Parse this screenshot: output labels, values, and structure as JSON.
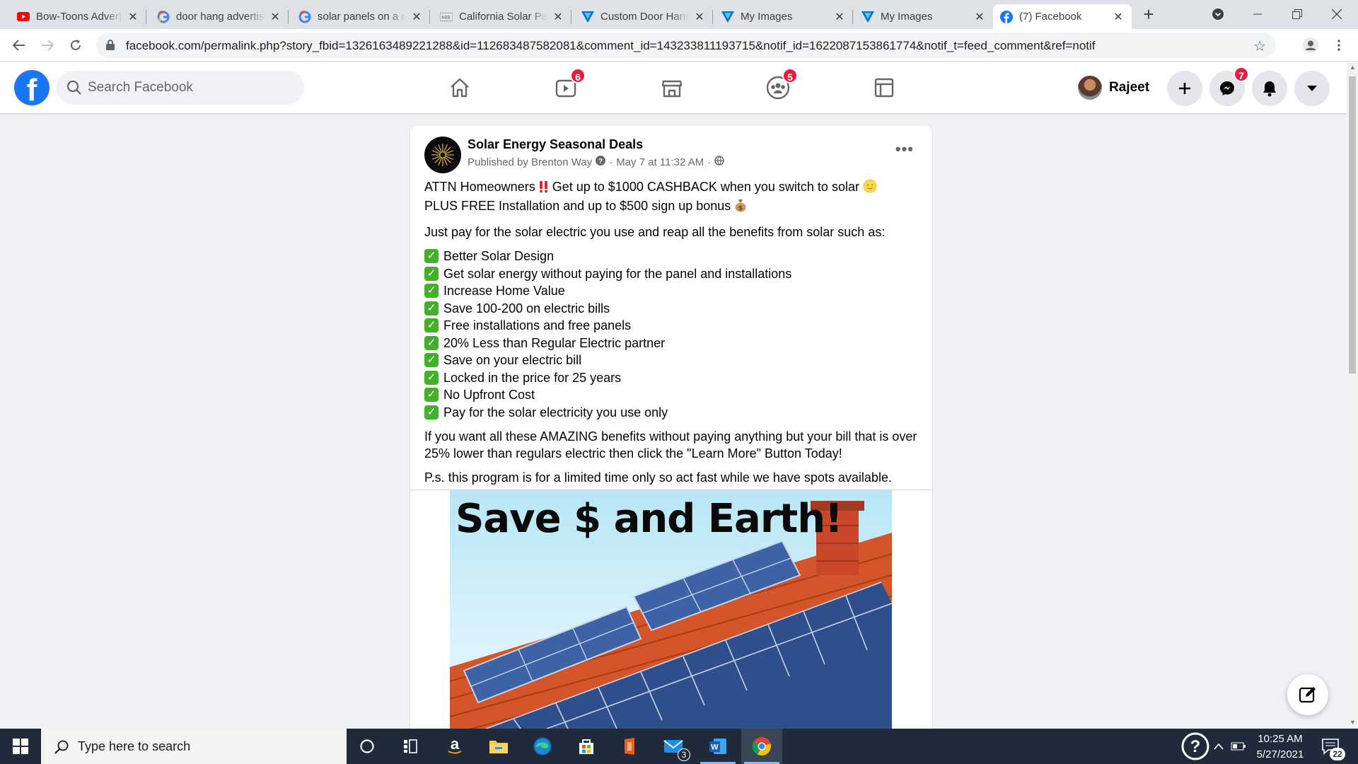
{
  "browser": {
    "tabs": [
      {
        "title": "Bow-Toons Advertising"
      },
      {
        "title": "door hang advertising"
      },
      {
        "title": "solar panels on a roof"
      },
      {
        "title": "California Solar Panels"
      },
      {
        "title": "Custom Door Hangers"
      },
      {
        "title": "My Images"
      },
      {
        "title": "My Images"
      },
      {
        "title": "(7) Facebook"
      }
    ],
    "url": "facebook.com/permalink.php?story_fbid=1326163489221288&id=112683487582081&comment_id=143233811193715&notif_id=1622087153861774&notif_t=feed_comment&ref=notif"
  },
  "fb": {
    "search_placeholder": "Search Facebook",
    "watch_badge": "6",
    "groups_badge": "5",
    "messenger_badge": "7",
    "profile_name": "Rajeet"
  },
  "post": {
    "page_name": "Solar Energy Seasonal Deals",
    "meta_author": "Published by Brenton Way",
    "meta_date": "May 7 at 11:32 AM",
    "para1_a": "ATTN Homeowners",
    "para1_b": " Get up to $1000 CASHBACK when you switch to solar ",
    "para1_c": "PLUS FREE Installation and up to $500 sign up bonus ",
    "para2": "Just pay for the solar electric you use  and reap all the benefits from solar such as:",
    "benefits": [
      "Better Solar Design",
      "Get solar energy without paying for the panel and installations",
      "Increase Home Value",
      "Save 100-200 on electric bills",
      "Free installations and free panels",
      "20% Less than Regular Electric partner",
      "Save on your electric bill",
      "Locked in the price for 25 years",
      "No Upfront Cost",
      "Pay for the solar electricity you use only"
    ],
    "para3": "If you want all these AMAZING benefits without paying anything but your bill that is over 25% lower than regulars electric then click the \"Learn More\" Button Today!",
    "para4": "P.s. this program is for a limited time only so act fast while we have spots available.",
    "image_headline": "Save $ and Earth!"
  },
  "taskbar": {
    "search_placeholder": "Type here to search",
    "mail_count": "3",
    "time": "10:25 AM",
    "date": "5/27/2021",
    "notif_count": "22"
  },
  "colors": {
    "fb_blue": "#1877f2",
    "badge_red": "#e41e3f",
    "check_green": "#43b02a",
    "taskbar": "#1f2b3a"
  }
}
